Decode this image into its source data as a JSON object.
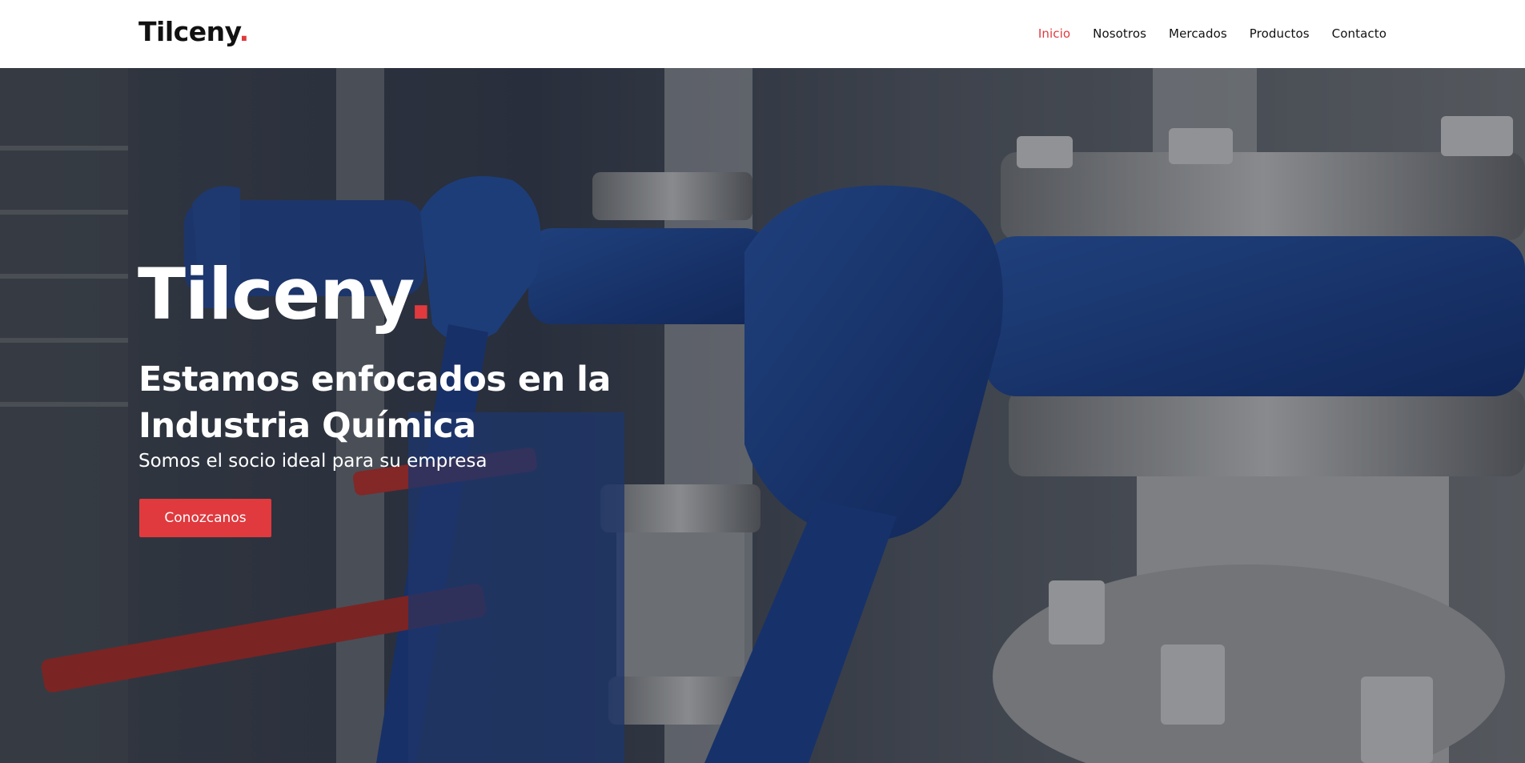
{
  "brand": {
    "name": "Tilceny",
    "dot": ".",
    "accent": "#e03a3e"
  },
  "nav": {
    "items": [
      {
        "label": "Inicio",
        "active": true
      },
      {
        "label": "Nosotros",
        "active": false
      },
      {
        "label": "Mercados",
        "active": false
      },
      {
        "label": "Productos",
        "active": false
      },
      {
        "label": "Contacto",
        "active": false
      }
    ]
  },
  "hero": {
    "title": "Tilceny",
    "title_dot": ".",
    "subtitle": "Estamos enfocados en la Industria Química",
    "tagline": "Somos el socio ideal para su empresa",
    "cta_label": "Conozcanos",
    "background_image": "industrial-valves-photo"
  }
}
